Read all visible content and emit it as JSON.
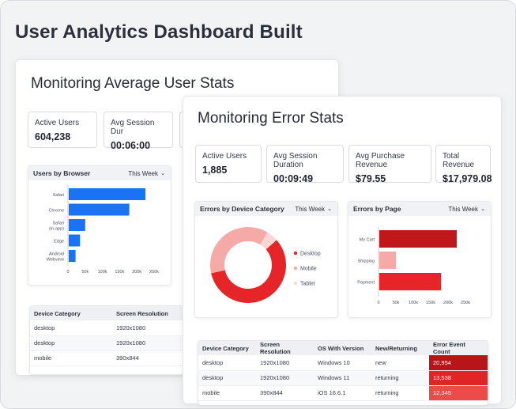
{
  "page": {
    "title": "User Analytics Dashboard Built"
  },
  "avg_card": {
    "title": "Monitoring Average User Stats",
    "stats": [
      {
        "label": "Active Users",
        "value": "604,238"
      },
      {
        "label": "Avg Session Dur",
        "value": "00:06:00"
      }
    ],
    "browser_panel": {
      "title": "Users by Browser",
      "range": "This Week"
    },
    "table": {
      "headers": [
        "Device Category",
        "Screen Resolution"
      ],
      "rows": [
        [
          "desktop",
          "1920x1080"
        ],
        [
          "desktop",
          "1920x1080"
        ],
        [
          "mobile",
          "390x844"
        ]
      ]
    }
  },
  "error_card": {
    "title": "Monitoring Error Stats",
    "stats": [
      {
        "label": "Active Users",
        "value": "1,885"
      },
      {
        "label": "Avg Session Duration",
        "value": "00:09:49"
      },
      {
        "label": "Avg Purchase Revenue",
        "value": "$79.55"
      },
      {
        "label": "Total Revenue",
        "value": "$17,979.08"
      }
    ],
    "device_panel": {
      "title": "Errors by Device Category",
      "range": "This Week"
    },
    "page_panel": {
      "title": "Errors by Page",
      "range": "This Week"
    },
    "table": {
      "headers": [
        "Device Category",
        "Screen Resolution",
        "OS With Version",
        "New/Returning",
        "Error Event Count"
      ],
      "rows": [
        {
          "device": "desktop",
          "resolution": "1920x1080",
          "os": "Windows 10",
          "type": "new",
          "count": "20,954"
        },
        {
          "device": "desktop",
          "resolution": "1920x1080",
          "os": "Windows 11",
          "type": "returning",
          "count": "13,538"
        },
        {
          "device": "mobile",
          "resolution": "390x844",
          "os": "iOS 16.6.1",
          "type": "returning",
          "count": "12,345"
        }
      ]
    }
  },
  "chart_data": [
    {
      "type": "bar",
      "orientation": "horizontal",
      "title": "Users by Browser",
      "categories": [
        "Safari",
        "Chrome",
        "Safari (in-app)",
        "Edge",
        "Android Webview"
      ],
      "values": [
        225000,
        178000,
        50000,
        35000,
        22000
      ],
      "xticks": [
        "0",
        "50k",
        "100k",
        "150k",
        "200k",
        "250k"
      ],
      "xlim": [
        0,
        250000
      ],
      "color": "#1a73f5"
    },
    {
      "type": "pie",
      "donut": true,
      "title": "Errors by Device Category",
      "labels": [
        "Desktop",
        "Mobile",
        "Tablet"
      ],
      "values": [
        58,
        37,
        5
      ],
      "colors": [
        "#e52528",
        "#f6aaa7",
        "#fcd6d2"
      ],
      "legend": "right"
    },
    {
      "type": "bar",
      "orientation": "horizontal",
      "title": "Errors by Page",
      "categories": [
        "My Cart",
        "Shipping",
        "Payment"
      ],
      "values": [
        225000,
        50000,
        180000
      ],
      "xticks": [
        "0",
        "50k",
        "100k",
        "150k",
        "200k",
        "250k"
      ],
      "xlim": [
        0,
        250000
      ],
      "colors": [
        "#c0171a",
        "#f6aaa7",
        "#e52528"
      ]
    }
  ],
  "heat_colors": [
    "#b8151a",
    "#e12424",
    "#ec4b4a"
  ]
}
